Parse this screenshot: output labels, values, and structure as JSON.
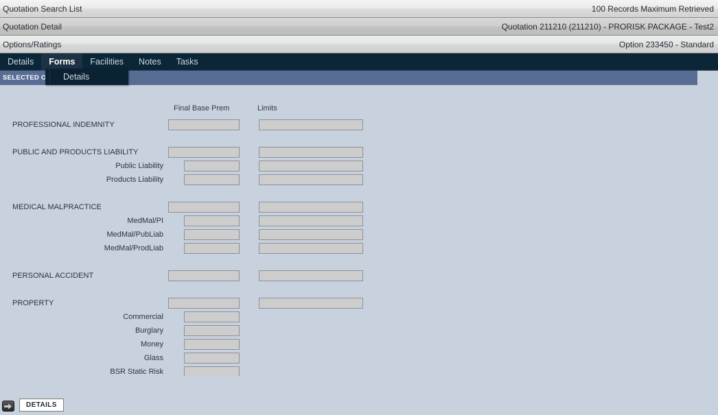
{
  "context_bars": [
    {
      "left": "Quotation Search List",
      "right": "100 Records Maximum Retrieved"
    },
    {
      "left": "Quotation Detail",
      "right": "Quotation 211210 (211210) - PRORISK PACKAGE - Test2"
    },
    {
      "left": "Options/Ratings",
      "right": "Option 233450 - Standard"
    }
  ],
  "tabs": [
    {
      "label": "Details",
      "active": false
    },
    {
      "label": "Forms",
      "active": true
    },
    {
      "label": "Facilities",
      "active": false
    },
    {
      "label": "Notes",
      "active": false
    },
    {
      "label": "Tasks",
      "active": false
    }
  ],
  "dropdown": {
    "items": [
      {
        "label": "Details"
      }
    ]
  },
  "selected_option_bar": {
    "label": "SELECTED OPTION"
  },
  "form": {
    "columns": {
      "premium": "Final Base Prem",
      "limits": "Limits"
    },
    "sections": [
      {
        "title": "PROFESSIONAL INDEMNITY",
        "premium_value": "",
        "limits_value": "",
        "items": []
      },
      {
        "title": "PUBLIC AND PRODUCTS LIABILITY",
        "premium_value": "",
        "limits_value": "",
        "items": [
          {
            "label": "Public Liability",
            "premium_value": "",
            "limits_value": "",
            "has_limits": true
          },
          {
            "label": "Products Liability",
            "premium_value": "",
            "limits_value": "",
            "has_limits": true
          }
        ]
      },
      {
        "title": "MEDICAL MALPRACTICE",
        "premium_value": "",
        "limits_value": "",
        "items": [
          {
            "label": "MedMal/PI",
            "premium_value": "",
            "limits_value": "",
            "has_limits": true
          },
          {
            "label": "MedMal/PubLiab",
            "premium_value": "",
            "limits_value": "",
            "has_limits": true
          },
          {
            "label": "MedMal/ProdLiab",
            "premium_value": "",
            "limits_value": "",
            "has_limits": true
          }
        ]
      },
      {
        "title": "PERSONAL ACCIDENT",
        "premium_value": "",
        "limits_value": "",
        "items": []
      },
      {
        "title": "PROPERTY",
        "premium_value": "",
        "limits_value": "",
        "items": [
          {
            "label": "Commercial",
            "premium_value": "",
            "has_limits": false
          },
          {
            "label": "Burglary",
            "premium_value": "",
            "has_limits": false
          },
          {
            "label": "Money",
            "premium_value": "",
            "has_limits": false
          },
          {
            "label": "Glass",
            "premium_value": "",
            "has_limits": false
          },
          {
            "label": "BSR Static Risk",
            "premium_value": "",
            "has_limits": false
          }
        ]
      }
    ]
  },
  "bottom": {
    "details_tab_label": "DETAILS",
    "arrow_icon": "arrow-right-icon"
  },
  "colors": {
    "page_background": "#c8d1de",
    "tabstrip": "#0b2637",
    "tab_active": "#1d3244",
    "selected_bar": "#576d94",
    "dropdown": "#0a2233",
    "field_fill": "#cdcdcd",
    "field_border": "#8d9199"
  }
}
